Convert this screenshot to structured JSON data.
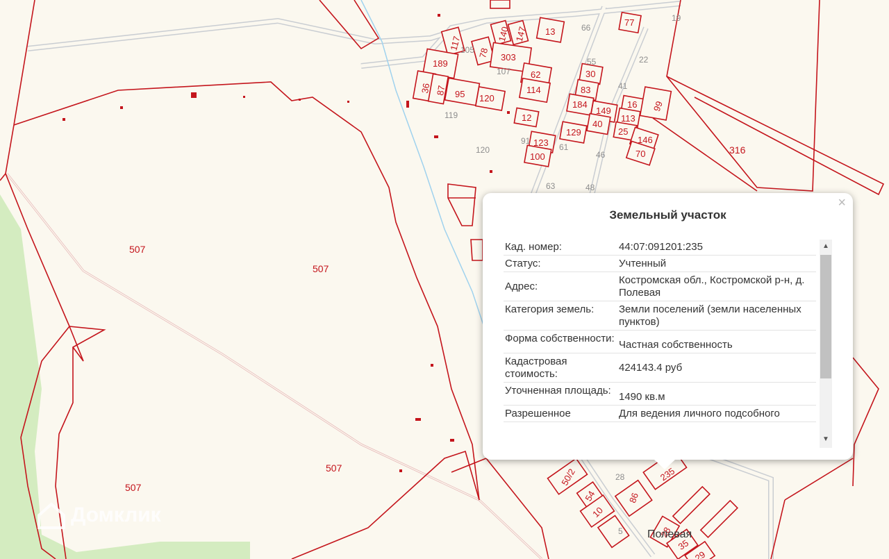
{
  "map": {
    "parcels": [
      {
        "label": "507",
        "id": "p1"
      },
      {
        "label": "507",
        "id": "p2"
      },
      {
        "label": "507",
        "id": "p3"
      },
      {
        "label": "507",
        "id": "p4"
      },
      {
        "label": "316",
        "id": "p5"
      },
      {
        "label": "117"
      },
      {
        "label": "78"
      },
      {
        "label": "140"
      },
      {
        "label": "147"
      },
      {
        "label": "303"
      },
      {
        "label": "13"
      },
      {
        "label": "77"
      },
      {
        "label": "189"
      },
      {
        "label": "36"
      },
      {
        "label": "87"
      },
      {
        "label": "95"
      },
      {
        "label": "120"
      },
      {
        "label": "62"
      },
      {
        "label": "114"
      },
      {
        "label": "30"
      },
      {
        "label": "83"
      },
      {
        "label": "184"
      },
      {
        "label": "149"
      },
      {
        "label": "40"
      },
      {
        "label": "129"
      },
      {
        "label": "16"
      },
      {
        "label": "113"
      },
      {
        "label": "25"
      },
      {
        "label": "146"
      },
      {
        "label": "70"
      },
      {
        "label": "99"
      },
      {
        "label": "12"
      },
      {
        "label": "123"
      },
      {
        "label": "100"
      },
      {
        "label": "50/2"
      },
      {
        "label": "54"
      },
      {
        "label": "10"
      },
      {
        "label": "86"
      },
      {
        "label": "235"
      },
      {
        "label": "28"
      },
      {
        "label": "35"
      },
      {
        "label": "29"
      }
    ],
    "house_numbers": [
      "66",
      "19",
      "55",
      "22",
      "41",
      "105",
      "107",
      "119",
      "120",
      "91",
      "61",
      "46",
      "63",
      "48",
      "28",
      "5"
    ],
    "street_label": "Полевая",
    "watermark": "Домклик"
  },
  "popup": {
    "title": "Земельный участок",
    "close_label": "×",
    "rows": [
      {
        "key": "Кад. номер:",
        "value": "44:07:091201:235"
      },
      {
        "key": "Статус:",
        "value": "Учтенный"
      },
      {
        "key": "Адрес:",
        "value": "Костромская обл., Костромской р-н, д. Полевая"
      },
      {
        "key": "Категория земель:",
        "value": "Земли поселений (земли населенных пунктов)"
      },
      {
        "key": "Форма собственности:",
        "value": "Частная собственность"
      },
      {
        "key": "Кадастровая стоимость:",
        "value": "424143.4 руб"
      },
      {
        "key": "Уточненная площадь:",
        "value": "1490 кв.м"
      },
      {
        "key": "Разрешенное",
        "value": "Для ведения личного подсобного"
      }
    ],
    "scroll_up_icon": "▲",
    "scroll_down_icon": "▼"
  },
  "colors": {
    "parcel": "#c4151c",
    "background": "#fbf8ef",
    "green": "#d4ecc0",
    "road": "#c9cdd2",
    "river": "#9fd2ee"
  }
}
